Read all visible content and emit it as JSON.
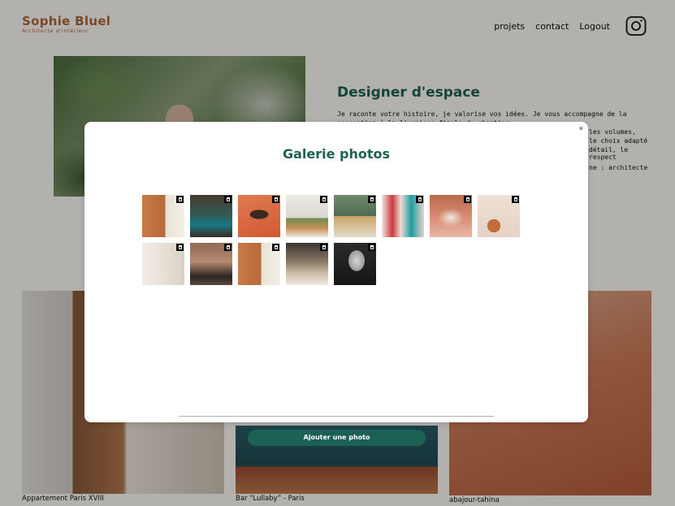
{
  "header": {
    "logo_title": "Sophie Bluel",
    "logo_subtitle": "Architecte d'intérieur",
    "nav": [
      "projets",
      "contact",
      "Logout"
    ],
    "social_icon": "instagram-icon"
  },
  "intro": {
    "title": "Designer d'espace",
    "paragraphs": [
      "Je raconte votre histoire, je valorise vos idées. Je vous accompagne de la",
      "conception à la livraison finale du chantier.",
      "les volumes,",
      "le choix adapté",
      "détail, le respect",
      "ne : architecte"
    ]
  },
  "works": [
    {
      "caption": "Appartement Paris XVIII"
    },
    {
      "caption": "Bar “Lullaby” - Paris"
    },
    {
      "caption": "abajour-tahina"
    }
  ],
  "modal": {
    "close_label": "×",
    "title": "Galerie photos",
    "photos": [
      {
        "name": "photo-1",
        "icon": "trash-icon"
      },
      {
        "name": "photo-2",
        "icon": "trash-icon"
      },
      {
        "name": "photo-3",
        "icon": "trash-icon"
      },
      {
        "name": "photo-4",
        "icon": "trash-icon"
      },
      {
        "name": "photo-5",
        "icon": "trash-icon"
      },
      {
        "name": "photo-6",
        "icon": "trash-icon"
      },
      {
        "name": "photo-7",
        "icon": "trash-icon"
      },
      {
        "name": "photo-8",
        "icon": "trash-icon"
      },
      {
        "name": "photo-9",
        "icon": "trash-icon"
      },
      {
        "name": "photo-10",
        "icon": "trash-icon"
      },
      {
        "name": "photo-11",
        "icon": "trash-icon"
      },
      {
        "name": "photo-12",
        "icon": "trash-icon"
      },
      {
        "name": "photo-13",
        "icon": "trash-icon"
      }
    ],
    "add_button": "Ajouter une photo"
  },
  "colors": {
    "primary": "#1D6154",
    "logo": "#B1663C",
    "background": "#FFFEF8",
    "overlay": "rgba(0,0,0,0.3)"
  }
}
